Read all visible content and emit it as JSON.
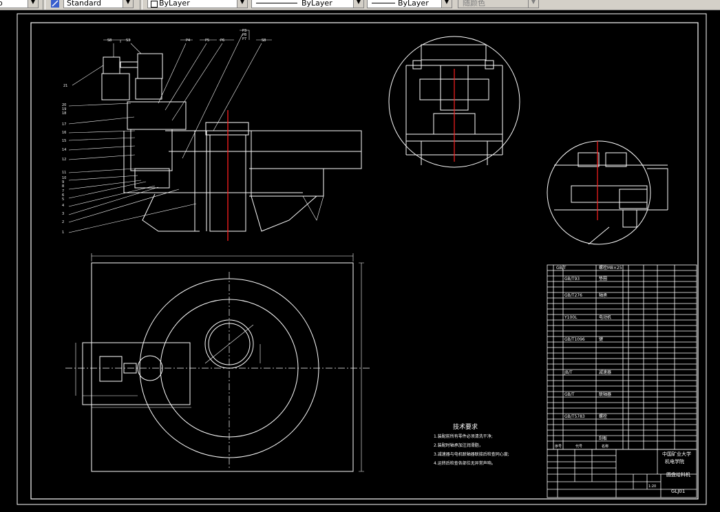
{
  "toolbar": {
    "textstyle": "Standard",
    "layer": "ByLayer",
    "linetype": "ByLayer",
    "lineweight": "ByLayer",
    "plotstyle": "随颜色"
  },
  "drawing": {
    "tech_title": "技术要求",
    "tech_lines": [
      "1.装配前所有零件必须清洗干净;",
      "2.装配时轴承加注润滑脂，",
      "3.减速器与电机联轴器联接后检查同心度;",
      "4.运转后检查各部位无异常声响。"
    ],
    "title_block": {
      "org": "中国矿业大学",
      "dept": "机电学院",
      "name": "圆盘给料机",
      "code": "GLJ01",
      "scale": "1:20"
    }
  }
}
